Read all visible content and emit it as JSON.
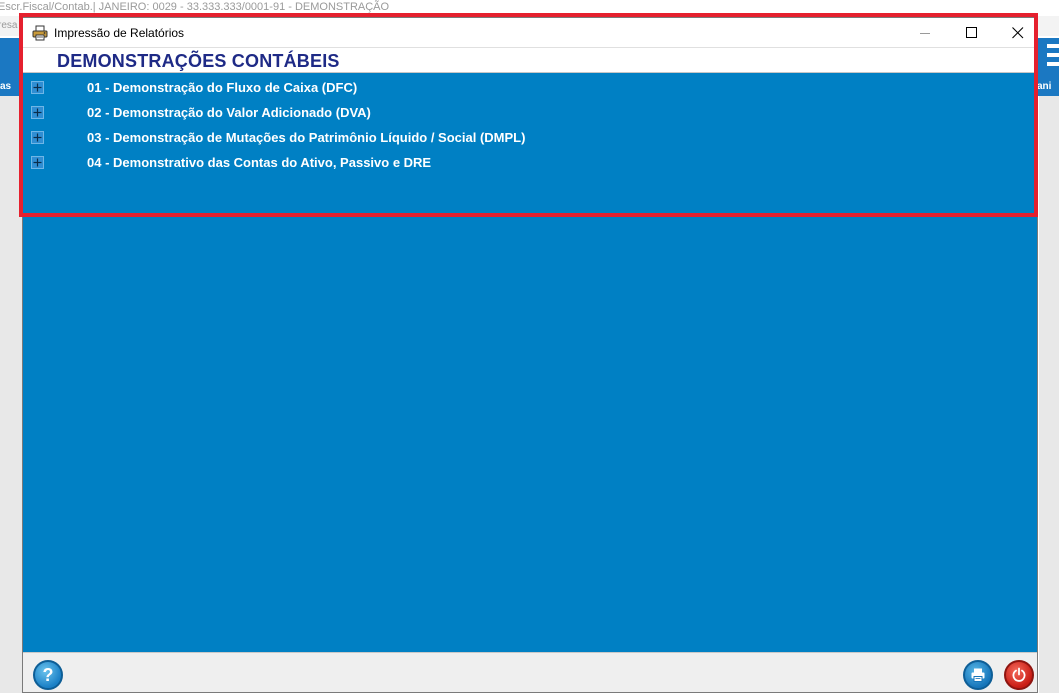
{
  "background": {
    "window_title": "Escr.Fiscal/Contab.| JANEIRO: 0029 - 33.333.333/0001-91 - DEMONSTRAÇÃO",
    "strip_text": "resa",
    "left_tab_label": "as",
    "right_tab_label": "ani"
  },
  "dialog": {
    "title": "Impressão de Relatórios",
    "header": "DEMONSTRAÇÕES CONTÁBEIS",
    "items": [
      {
        "label": "01 - Demonstração do Fluxo de Caixa (DFC)",
        "expanded": false
      },
      {
        "label": "02 - Demonstração do Valor Adicionado (DVA)",
        "expanded": false
      },
      {
        "label": "03 - Demonstração de Mutações do Patrimônio Líquido / Social (DMPL)",
        "expanded": false
      },
      {
        "label": "04 - Demonstrativo das Contas do Ativo, Passivo e DRE",
        "expanded": false
      }
    ],
    "help_glyph": "?"
  },
  "icons": {
    "app": "printer-report-icon",
    "minimize": "minimize-icon",
    "maximize": "maximize-icon",
    "close": "close-icon",
    "expand": "plus-icon",
    "help": "help-icon",
    "print": "printer-icon",
    "power": "power-icon"
  },
  "colors": {
    "dialog_background": "#0080c4",
    "header_text": "#1e2a86",
    "highlight_border": "#e5202e",
    "power_button": "#c91c14",
    "help_button": "#1b80c6"
  }
}
